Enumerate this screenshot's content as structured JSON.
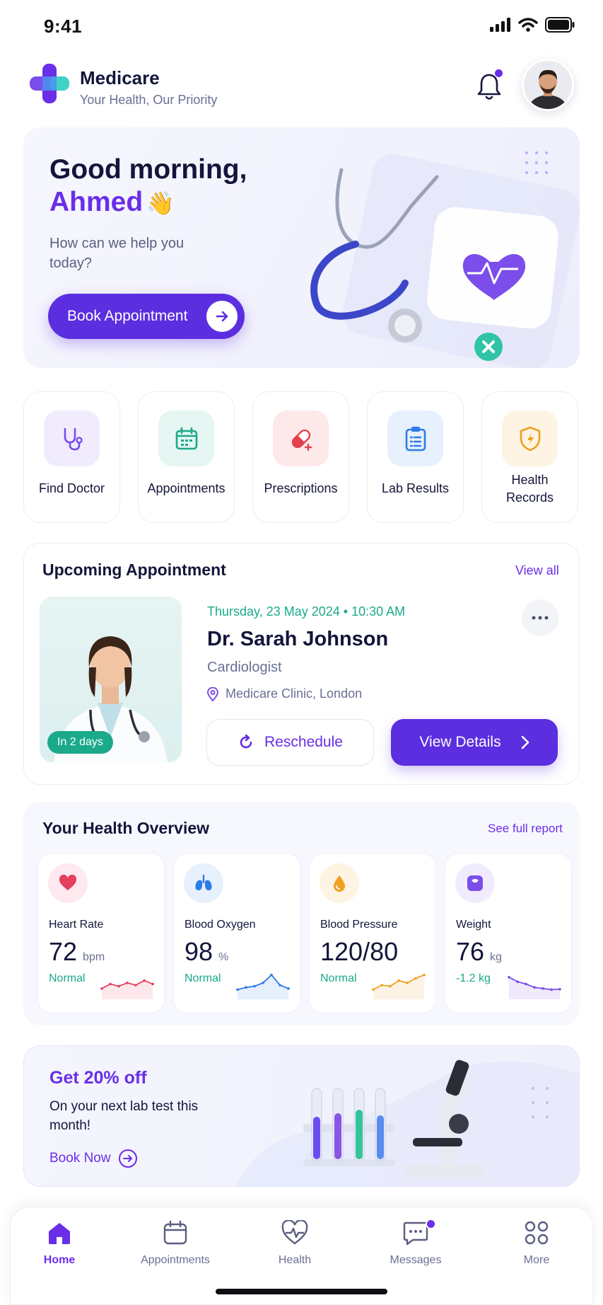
{
  "status": {
    "time": "9:41"
  },
  "header": {
    "brand": "Medicare",
    "tagline": "Your Health, Our Priority",
    "icons": [
      "medicare-logo",
      "bell-icon",
      "avatar"
    ]
  },
  "hero": {
    "greeting": "Good morning,",
    "name": "Ahmed",
    "emoji": "👋",
    "subtitle": "How can we help you today?",
    "cta": "Book Appointment"
  },
  "quick_actions": [
    {
      "label": "Find Doctor",
      "icon": "stethoscope-icon",
      "color": "#7b4dea",
      "bg": "#f1ecfd"
    },
    {
      "label": "Appointments",
      "icon": "calendar-icon",
      "color": "#1aaa8a",
      "bg": "#e6f6f2"
    },
    {
      "label": "Prescriptions",
      "icon": "pill-icon",
      "color": "#e4404e",
      "bg": "#fde9ea"
    },
    {
      "label": "Lab Results",
      "icon": "clipboard-icon",
      "color": "#2f7be6",
      "bg": "#e7f0fd"
    },
    {
      "label": "Health Records",
      "icon": "shield-icon",
      "color": "#f0a020",
      "bg": "#fef4e3"
    }
  ],
  "upcoming": {
    "title": "Upcoming Appointment",
    "view_all": "View all",
    "badge": "In 2 days",
    "date": "Thursday, 23 May 2024",
    "time": "10:30 AM",
    "doctor": "Dr. Sarah Johnson",
    "specialty": "Cardiologist",
    "location": "Medicare Clinic, London",
    "reschedule": "Reschedule",
    "details": "View Details"
  },
  "health": {
    "title": "Your Health Overview",
    "link": "See full report",
    "metrics": [
      {
        "label": "Heart Rate",
        "value": "72",
        "unit": "bpm",
        "status": "Normal",
        "color": "#e4405e",
        "icon": "heart-icon",
        "trend": [
          0.35,
          0.55,
          0.45,
          0.6,
          0.5,
          0.7,
          0.55
        ]
      },
      {
        "label": "Blood Oxygen",
        "value": "98",
        "unit": "%",
        "status": "Normal",
        "color": "#2f7be6",
        "icon": "lungs-icon",
        "trend": [
          0.3,
          0.4,
          0.45,
          0.6,
          0.95,
          0.5,
          0.35
        ]
      },
      {
        "label": "Blood Pressure",
        "value": "120/80",
        "unit": "",
        "status": "Normal",
        "color": "#f0a020",
        "icon": "drop-icon",
        "trend": [
          0.3,
          0.5,
          0.45,
          0.7,
          0.6,
          0.8,
          0.95
        ]
      },
      {
        "label": "Weight",
        "value": "76",
        "unit": "kg",
        "status": "-1.2 kg",
        "color": "#7b4dea",
        "icon": "scale-icon",
        "trend": [
          0.85,
          0.65,
          0.55,
          0.4,
          0.35,
          0.3,
          0.32
        ]
      }
    ]
  },
  "promo": {
    "title": "Get 20% off",
    "subtitle": "On your next lab test this month!",
    "link": "Book Now"
  },
  "nav": [
    {
      "label": "Home",
      "icon": "home-icon",
      "active": true
    },
    {
      "label": "Appointments",
      "icon": "calendar-icon",
      "active": false
    },
    {
      "label": "Health",
      "icon": "heart-pulse-icon",
      "active": false
    },
    {
      "label": "Messages",
      "icon": "message-icon",
      "active": false
    },
    {
      "label": "More",
      "icon": "grid-icon",
      "active": false
    }
  ]
}
